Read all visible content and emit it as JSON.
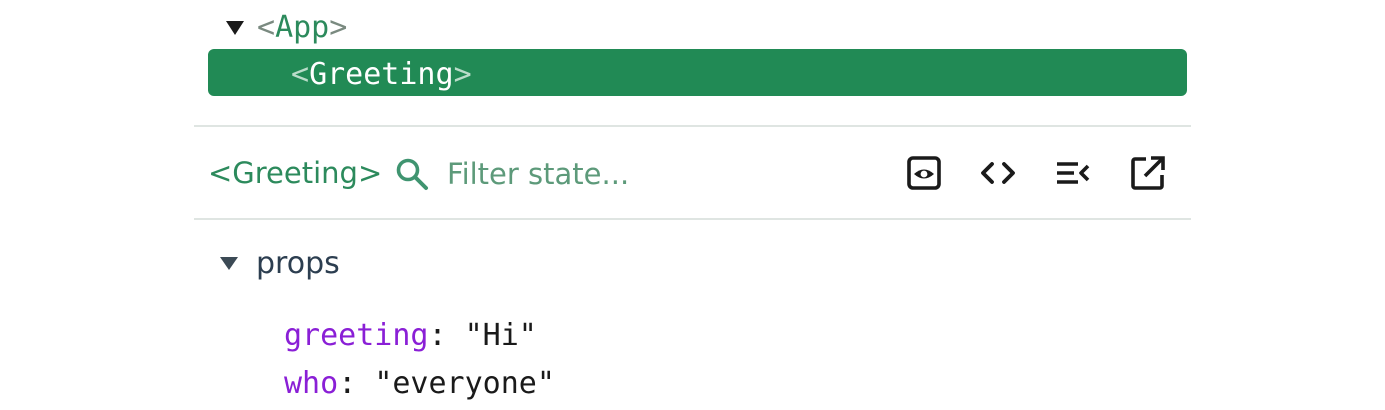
{
  "tree": {
    "root": {
      "name": "App",
      "open": "<",
      "close": ">"
    },
    "selected": {
      "name": "Greeting",
      "open": "<",
      "close": ">"
    }
  },
  "inspector": {
    "component_label": "<Greeting>",
    "search": {
      "placeholder": "Filter state..."
    },
    "tools": [
      {
        "icon": "eye-icon",
        "label": "Inspect the matching DOM element"
      },
      {
        "icon": "code-icon",
        "label": "View source"
      },
      {
        "icon": "log-icon",
        "label": "Log data to console"
      },
      {
        "icon": "external-link-icon",
        "label": "Open in editor"
      }
    ]
  },
  "props": {
    "header": "props",
    "items": [
      {
        "key": "greeting",
        "colon": ": ",
        "value": "\"Hi\""
      },
      {
        "key": "who",
        "colon": ": ",
        "value": "\"everyone\""
      }
    ]
  },
  "colors": {
    "selected_bg": "#218a55",
    "accent_green": "#2c8a5c",
    "prop_key": "#8a1fd6"
  }
}
